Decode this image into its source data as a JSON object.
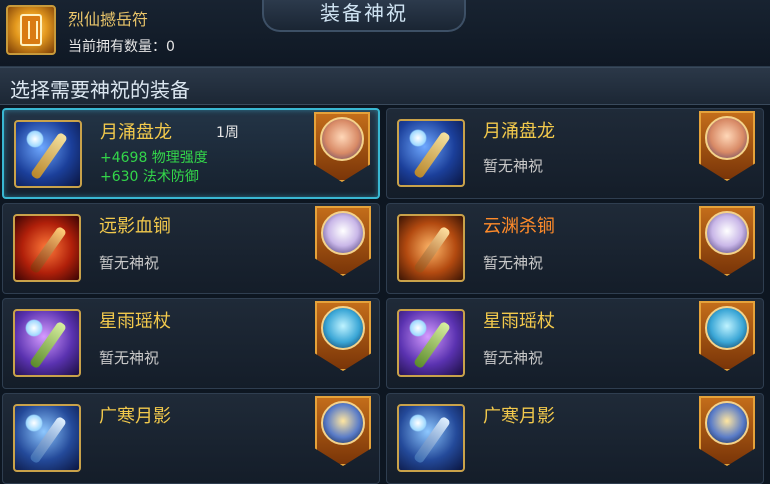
{
  "header": {
    "charm_name": "烈仙撼岳符",
    "owned_label": "当前拥有数量：0",
    "title": "装备神祝",
    "charm_icon": "talisman-icon"
  },
  "section": {
    "title": "选择需要神祝的装备"
  },
  "colors": {
    "accent": "#39b7d2",
    "gold": "#f2c94c",
    "orange": "#ff8b2a",
    "green": "#33d64a"
  },
  "items": [
    {
      "name": "月涌盘龙",
      "weeks": "1周",
      "stats": [
        "+4698 物理强度",
        "+630 法术防御"
      ],
      "status": "",
      "icon": "chain-weapon-icon",
      "hero": "pig-hero-avatar",
      "selected": true
    },
    {
      "name": "月涌盘龙",
      "weeks": "",
      "stats": [],
      "status": "暂无神祝",
      "icon": "chain-weapon-icon",
      "hero": "pig-hero-avatar",
      "selected": false
    },
    {
      "name": "远影血锏",
      "weeks": "",
      "stats": [],
      "status": "暂无神祝",
      "icon": "mace-weapon-icon",
      "hero": "cat-hero-avatar",
      "selected": false
    },
    {
      "name": "云渊杀锏",
      "weeks": "",
      "stats": [],
      "status": "暂无神祝",
      "icon": "mace-weapon-icon",
      "hero": "cat-hero-avatar",
      "selected": false
    },
    {
      "name": "星雨瑶杖",
      "weeks": "",
      "stats": [],
      "status": "暂无神祝",
      "icon": "staff-weapon-icon",
      "hero": "mage-hero-avatar",
      "selected": false
    },
    {
      "name": "星雨瑶杖",
      "weeks": "",
      "stats": [],
      "status": "暂无神祝",
      "icon": "staff-weapon-icon",
      "hero": "mage-hero-avatar",
      "selected": false
    },
    {
      "name": "广寒月影",
      "weeks": "",
      "stats": [],
      "status": "",
      "icon": "blade-weapon-icon",
      "hero": "knight-hero-avatar",
      "selected": false
    },
    {
      "name": "广寒月影",
      "weeks": "",
      "stats": [],
      "status": "",
      "icon": "blade-weapon-icon",
      "hero": "knight-hero-avatar",
      "selected": false
    }
  ]
}
